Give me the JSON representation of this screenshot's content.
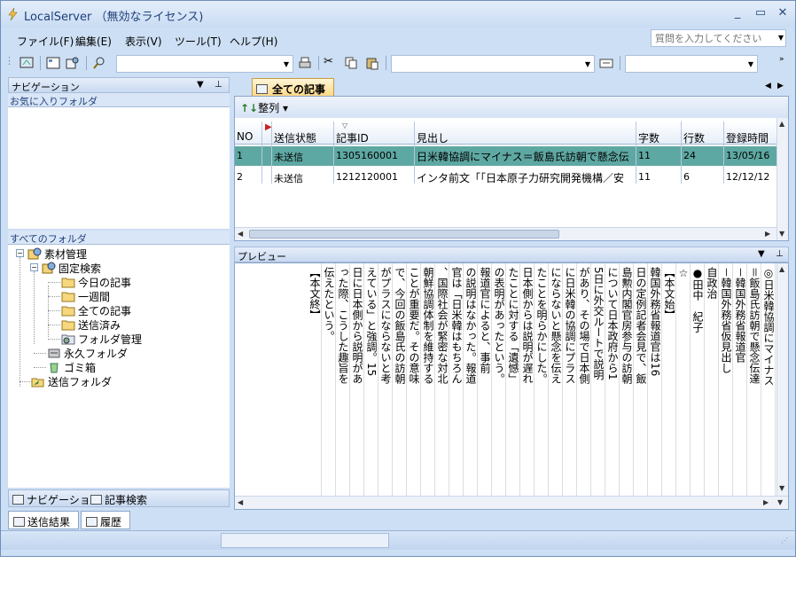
{
  "window": {
    "title": "LocalServer （無効なライセンス)"
  },
  "menu": {
    "items": [
      "ファイル(F)",
      "編集(E)",
      "表示(V)",
      "ツール(T)",
      "ヘルプ(H)"
    ]
  },
  "help": {
    "placeholder": "質問を入力してください"
  },
  "navigation": {
    "title": "ナビゲーション",
    "favorites_label": "お気に入りフォルダ",
    "all_folders_label": "すべてのフォルダ",
    "tree": {
      "root": "素材管理",
      "fixed_search": "固定検索",
      "today": "今日の記事",
      "week": "一週間",
      "all_articles": "全ての記事",
      "sent": "送信済み",
      "folder_mgmt": "フォルダ管理",
      "permanent": "永久フォルダ",
      "trash": "ゴミ箱",
      "send_folder": "送信フォルダ"
    },
    "tab_nav": "ナビゲーション",
    "tab_search": "記事検索"
  },
  "bottom_tabs": {
    "results": "送信結果",
    "history": "履歴"
  },
  "document": {
    "tab_label": "全ての記事",
    "sort_label": "整列",
    "columns": [
      "NO",
      "送信状態",
      "記事ID",
      "見出し",
      "字数",
      "行数",
      "登録時間"
    ],
    "rows": [
      {
        "no": "1",
        "status": "未送信",
        "id": "1305160001",
        "headline": "日米韓協調にマイナス＝飯島氏訪朝で懸念伝",
        "chars": "11",
        "lines": "24",
        "time": "13/05/16"
      },
      {
        "no": "2",
        "status": "未送信",
        "id": "1212120001",
        "headline": "インタ前文「「日本原子力研究開発機構／安",
        "chars": "11",
        "lines": "6",
        "time": "12/12/12"
      }
    ]
  },
  "preview": {
    "title": "プレビュー",
    "columns": [
      "◎日米韓協調にマイナス",
      "＝飯島氏訪朝で懸念伝達",
      "－韓国外務省報道官",
      "－韓国外務省仮見出し",
      "自政治",
      "●田中　紀子",
      "☆",
      "【本文始】",
      "韓国外務省報道官は16",
      "日の定例記者会見で、飯",
      "島勲内閣官房参与の訪朝",
      "について日本政府から1",
      "5日に外交ルートで説明",
      "があり、その場で日本側",
      "に日米韓の協調にプラス",
      "にならないと懸念を伝え",
      "たことを明らかにした。",
      "日本側からは説明が遅れ",
      "たことに対する「遺憾」",
      "の表明があったという。",
      "報道官によると、事前",
      "の説明はなかった。報道",
      "官は「日米韓はもちろん",
      "、国際社会が緊密な対北",
      "朝鮮協調体制を維持する",
      "ことが重要だ。その意味",
      "で、今回の飯島氏の訪朝",
      "がプラスにならないと考",
      "えている」と強調。15",
      "日に日本側から説明があ",
      "った際、こうした趣旨を",
      "伝えたという。",
      "【本文終】"
    ]
  }
}
